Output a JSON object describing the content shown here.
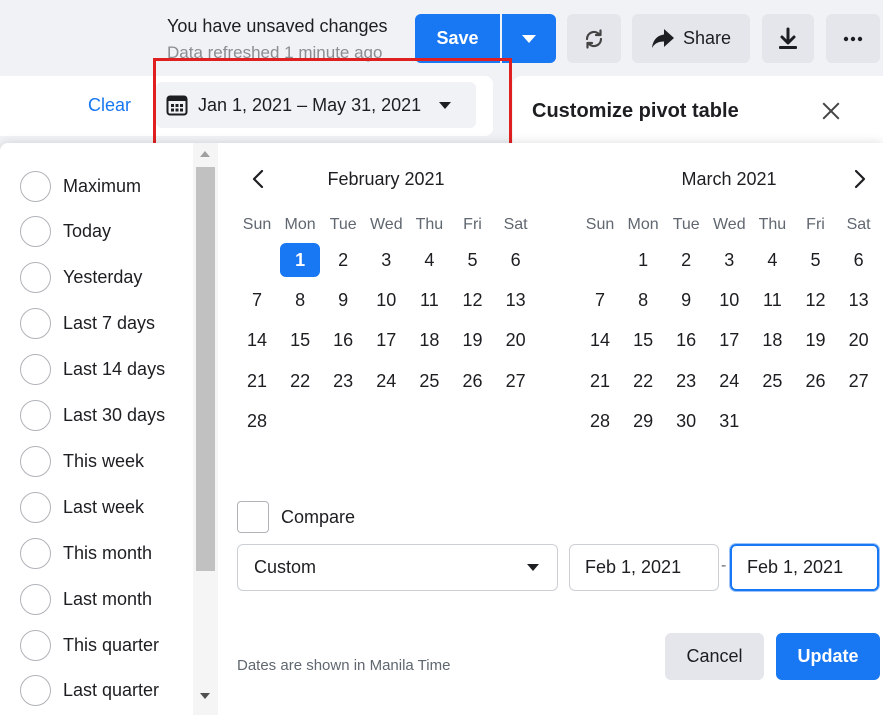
{
  "header": {
    "unsaved_text": "You have unsaved changes",
    "refreshed_text": "Data refreshed 1 minute ago",
    "save_label": "Save",
    "share_label": "Share"
  },
  "filter": {
    "clear_label": "Clear",
    "date_range": "Jan 1, 2021 – May 31, 2021"
  },
  "pivot": {
    "title": "Customize pivot table"
  },
  "presets": [
    "Maximum",
    "Today",
    "Yesterday",
    "Last 7 days",
    "Last 14 days",
    "Last 30 days",
    "This week",
    "Last week",
    "This month",
    "Last month",
    "This quarter",
    "Last quarter"
  ],
  "calendar": {
    "weekdays": [
      "Sun",
      "Mon",
      "Tue",
      "Wed",
      "Thu",
      "Fri",
      "Sat"
    ],
    "months": [
      {
        "title": "February 2021",
        "first_weekday": 1,
        "days": 28,
        "selected_day": 1
      },
      {
        "title": "March 2021",
        "first_weekday": 1,
        "days": 31,
        "selected_day": null
      }
    ]
  },
  "compare": {
    "label": "Compare",
    "checked": false
  },
  "range_select": {
    "value": "Custom"
  },
  "date_inputs": {
    "start": "Feb 1, 2021",
    "separator": "-",
    "end": "Feb 1, 2021"
  },
  "footer": {
    "timezone_note": "Dates are shown in Manila Time",
    "cancel_label": "Cancel",
    "update_label": "Update"
  },
  "colors": {
    "accent": "#1877f2",
    "highlight": "#e02020"
  }
}
